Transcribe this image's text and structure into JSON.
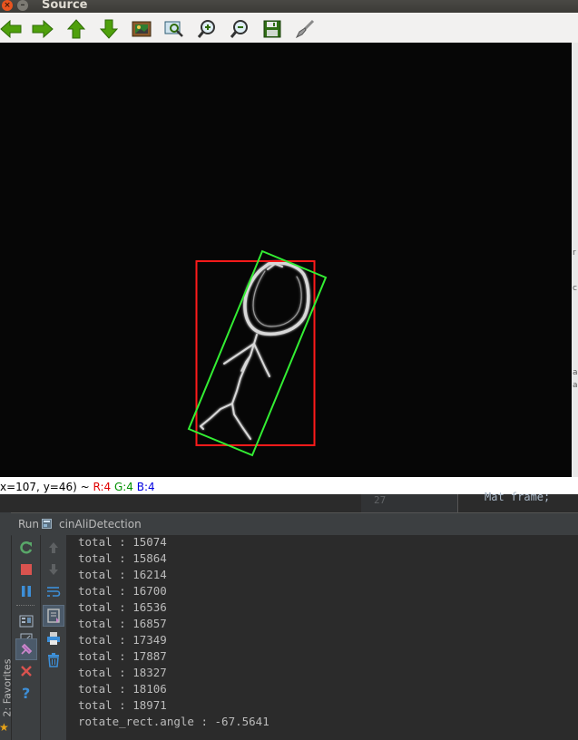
{
  "window": {
    "title": "Source",
    "toolbar_icons": [
      "arrow-left-icon",
      "arrow-right-icon",
      "arrow-up-icon",
      "arrow-down-icon",
      "picture-icon",
      "zoom-window-icon",
      "zoom-in-icon",
      "zoom-out-icon",
      "save-icon",
      "properties-brush-icon"
    ]
  },
  "status": {
    "coords": "x=107, y=46) ~ ",
    "r": "R:4",
    "g": "G:4",
    "b": "B:4"
  },
  "editor": {
    "line_number": "27",
    "code_peek": "Mat frame;"
  },
  "run_panel": {
    "run_label": "Run",
    "config_name": "cinAliDetection",
    "console_lines": [
      "total : 15074",
      "total : 15864",
      "total : 16214",
      "total : 16700",
      "total : 16536",
      "total : 16857",
      "total : 17349",
      "total : 17887",
      "total : 18327",
      "total : 18106",
      "total : 18971",
      "rotate_rect.angle : -67.5641"
    ]
  },
  "favorites_label": "2: Favorites",
  "colors": {
    "bounding_rect": "#ff1a1a",
    "rotated_rect": "#33ee33",
    "ide_background": "#2b2b2b",
    "panel": "#3c3f41"
  }
}
